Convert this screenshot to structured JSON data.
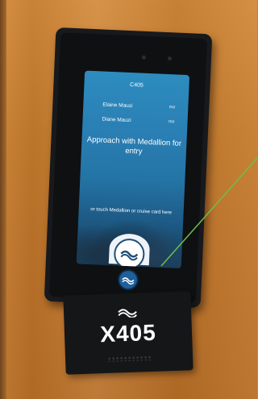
{
  "screen": {
    "room_number": "C405",
    "guests": [
      {
        "name": "Elaine Mauzi",
        "badge": "me"
      },
      {
        "name": "Diane Mauzi",
        "badge": "me"
      }
    ],
    "approach_message": "Approach with Medallion for entry",
    "touch_message": "or touch Medallion or cruise card here"
  },
  "plate": {
    "room_number": "X405"
  },
  "colors": {
    "wall": "#c9822f",
    "device": "#18191c",
    "screen_top": "#2d8cbf",
    "logo_blue": "#1f5f9a",
    "annotation_line": "#6cbf4a"
  },
  "icons": [
    "medallion-logo-icon",
    "wave-logo-icon",
    "camera-sensor-icon"
  ]
}
